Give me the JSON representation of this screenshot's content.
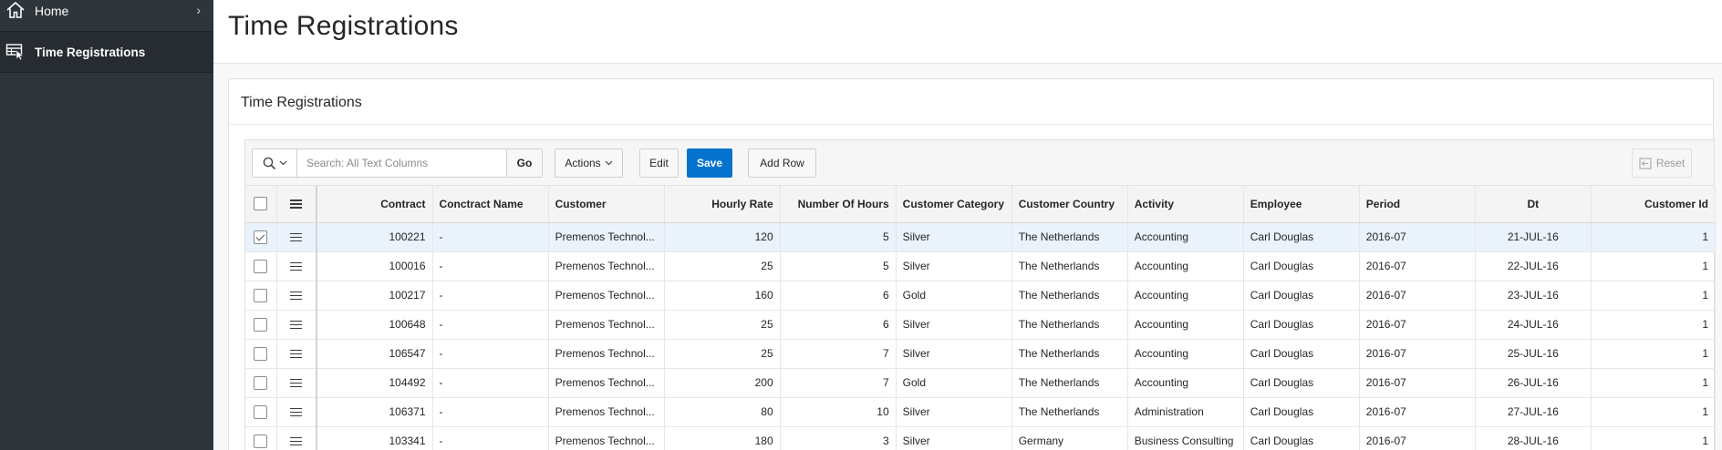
{
  "nav": {
    "items": [
      {
        "label": "Home",
        "icon": "home-icon"
      },
      {
        "label": "Time Registrations",
        "icon": "table-pointer-icon",
        "active": true
      }
    ]
  },
  "header": {
    "title": "Time Registrations"
  },
  "region": {
    "title": "Time Registrations"
  },
  "toolbar": {
    "search_placeholder": "Search: All Text Columns",
    "go_label": "Go",
    "actions_label": "Actions",
    "edit_label": "Edit",
    "save_label": "Save",
    "add_row_label": "Add Row",
    "reset_label": "Reset"
  },
  "colors": {
    "accent": "#0572ce",
    "sidebar": "#2e353b",
    "selected_row": "#eaf2fc"
  },
  "grid": {
    "columns": [
      "Contract",
      "Conctract Name",
      "Customer",
      "Hourly Rate",
      "Number Of Hours",
      "Customer Category",
      "Customer Country",
      "Activity",
      "Employee",
      "Period",
      "Dt",
      "Customer Id"
    ],
    "rows": [
      {
        "selected": true,
        "cells": [
          "100221",
          "-",
          "Premenos Technol...",
          "120",
          "5",
          "Silver",
          "The Netherlands",
          "Accounting",
          "Carl Douglas",
          "2016-07",
          "21-JUL-16",
          "1"
        ]
      },
      {
        "selected": false,
        "cells": [
          "100016",
          "-",
          "Premenos Technol...",
          "25",
          "5",
          "Silver",
          "The Netherlands",
          "Accounting",
          "Carl Douglas",
          "2016-07",
          "22-JUL-16",
          "1"
        ]
      },
      {
        "selected": false,
        "cells": [
          "100217",
          "-",
          "Premenos Technol...",
          "160",
          "6",
          "Gold",
          "The Netherlands",
          "Accounting",
          "Carl Douglas",
          "2016-07",
          "23-JUL-16",
          "1"
        ]
      },
      {
        "selected": false,
        "cells": [
          "100648",
          "-",
          "Premenos Technol...",
          "25",
          "6",
          "Silver",
          "The Netherlands",
          "Accounting",
          "Carl Douglas",
          "2016-07",
          "24-JUL-16",
          "1"
        ]
      },
      {
        "selected": false,
        "cells": [
          "106547",
          "-",
          "Premenos Technol...",
          "25",
          "7",
          "Silver",
          "The Netherlands",
          "Accounting",
          "Carl Douglas",
          "2016-07",
          "25-JUL-16",
          "1"
        ]
      },
      {
        "selected": false,
        "cells": [
          "104492",
          "-",
          "Premenos Technol...",
          "200",
          "7",
          "Gold",
          "The Netherlands",
          "Accounting",
          "Carl Douglas",
          "2016-07",
          "26-JUL-16",
          "1"
        ]
      },
      {
        "selected": false,
        "cells": [
          "106371",
          "-",
          "Premenos Technol...",
          "80",
          "10",
          "Silver",
          "The Netherlands",
          "Administration",
          "Carl Douglas",
          "2016-07",
          "27-JUL-16",
          "1"
        ]
      },
      {
        "selected": false,
        "cells": [
          "103341",
          "-",
          "Premenos Technol...",
          "180",
          "3",
          "Silver",
          "Germany",
          "Business Consulting",
          "Carl Douglas",
          "2016-07",
          "28-JUL-16",
          "1"
        ]
      }
    ]
  }
}
